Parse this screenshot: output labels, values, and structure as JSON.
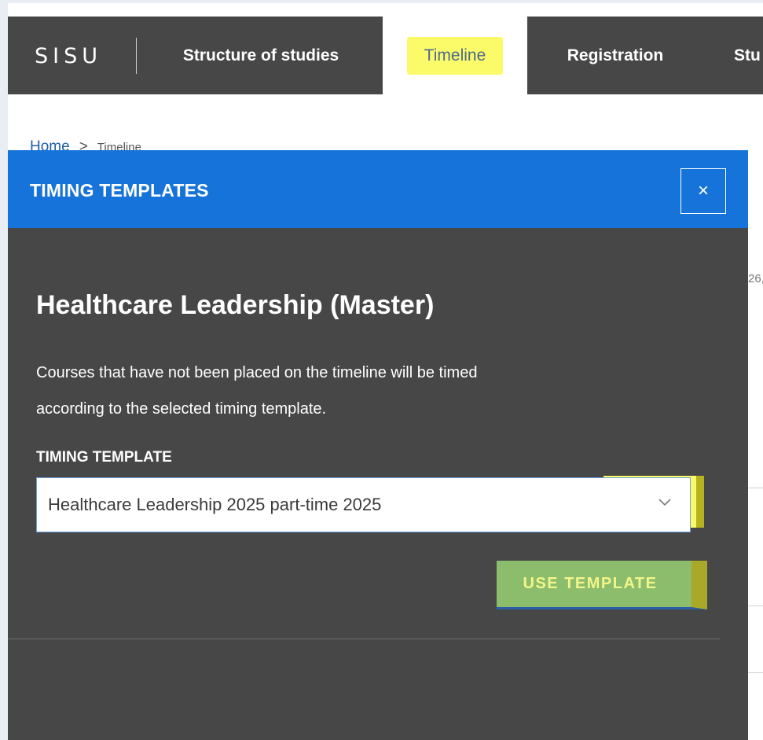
{
  "nav": {
    "logo": "SISU",
    "items": [
      {
        "label": "Structure of studies"
      },
      {
        "label": "Timeline"
      },
      {
        "label": "Registration"
      },
      {
        "label": "Stu"
      }
    ]
  },
  "breadcrumb": {
    "home": "Home",
    "separator": ">",
    "current": "Timeline"
  },
  "background": {
    "partial_text": "26,"
  },
  "modal": {
    "header_title": "TIMING TEMPLATES",
    "close_icon": "×",
    "program_title": "Healthcare Leadership (Master)",
    "description_line1": "Courses that have not been placed on the timeline will be timed",
    "description_line2": "according to the selected timing template.",
    "field_label": "TIMING TEMPLATE",
    "selected_template": "Healthcare Leadership 2025 part-time 2025",
    "use_button_label": "USE TEMPLATE"
  },
  "icons": {
    "close": "close-icon",
    "dropdown": "chevron-down-icon"
  },
  "colors": {
    "topbar": "#474747",
    "modal_header": "#1673d9",
    "modal_body": "#474747",
    "highlight": "#fbfb6a",
    "button": "#8cbd6c"
  }
}
